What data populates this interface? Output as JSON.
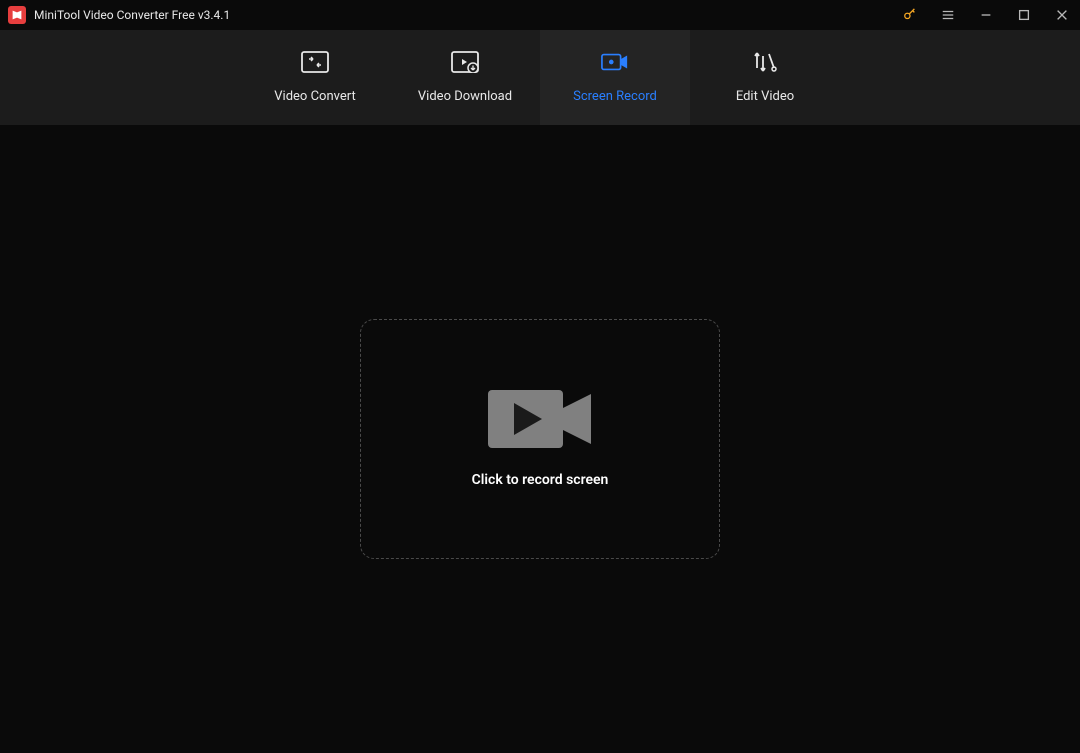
{
  "app": {
    "title": "MiniTool Video Converter Free v3.4.1"
  },
  "tabs": [
    {
      "label": "Video Convert"
    },
    {
      "label": "Video Download"
    },
    {
      "label": "Screen Record"
    },
    {
      "label": "Edit Video"
    }
  ],
  "main": {
    "record_prompt": "Click to record screen"
  }
}
